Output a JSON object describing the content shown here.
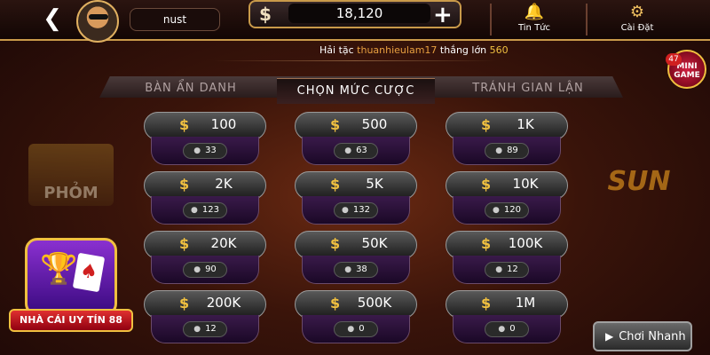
{
  "header": {
    "back_icon": "back-arrow-icon",
    "username": "nust",
    "currency_icon": "$",
    "balance": "18,120",
    "add_icon": "+",
    "news_label": "Tin Tức",
    "settings_label": "Cài Đặt"
  },
  "ticker": {
    "prefix": "Hải tặc",
    "player": "thuanhieulam17",
    "action": "thắng lớn",
    "amount": "560"
  },
  "tabs": [
    {
      "label": "BÀN ẨN DANH"
    },
    {
      "label": "CHỌN MỨC CƯỢC"
    },
    {
      "label": "TRÁNH GIAN LẬN"
    }
  ],
  "side": {
    "mini_game_label": "MINI GAME",
    "mini_game_count": "47",
    "game_logo": "PHỎM",
    "brand_logo": "SUN",
    "brand_badge": "NHÀ CÁI UY TÍN 88",
    "quick_play_label": "Chơi Nhanh"
  },
  "tables": [
    {
      "bet": "100",
      "players": "33"
    },
    {
      "bet": "500",
      "players": "63"
    },
    {
      "bet": "1K",
      "players": "89"
    },
    {
      "bet": "2K",
      "players": "123"
    },
    {
      "bet": "5K",
      "players": "132"
    },
    {
      "bet": "10K",
      "players": "120"
    },
    {
      "bet": "20K",
      "players": "90"
    },
    {
      "bet": "50K",
      "players": "38"
    },
    {
      "bet": "100K",
      "players": "12"
    },
    {
      "bet": "200K",
      "players": "12"
    },
    {
      "bet": "500K",
      "players": "0"
    },
    {
      "bet": "1M",
      "players": "0"
    }
  ],
  "colors": {
    "accent": "#c99a4a",
    "gold": "#f0c040"
  }
}
